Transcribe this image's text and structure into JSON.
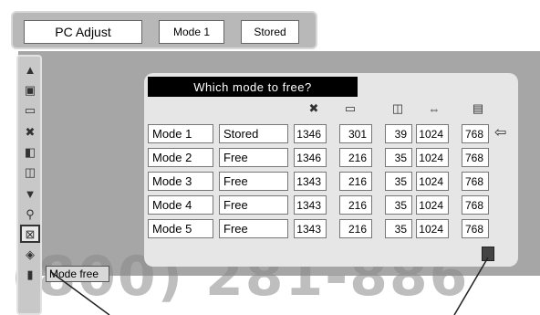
{
  "menu": {
    "title": "PC Adjust",
    "mode_label": "Mode 1",
    "stored_label": "Stored"
  },
  "sidebar": {
    "icons": [
      {
        "name": "up-arrow-icon",
        "glyph": "▲"
      },
      {
        "name": "monitor-icon",
        "glyph": "▣"
      },
      {
        "name": "fine-sync-icon",
        "glyph": "▭"
      },
      {
        "name": "total-dots-icon",
        "glyph": "✖"
      },
      {
        "name": "horizontal-icon",
        "glyph": "◧"
      },
      {
        "name": "vertical-icon",
        "glyph": "◫"
      },
      {
        "name": "down-arrow-icon",
        "glyph": "▼"
      },
      {
        "name": "reset-icon",
        "glyph": "⚲"
      },
      {
        "name": "mode-free-icon",
        "glyph": "⊠"
      },
      {
        "name": "store-icon",
        "glyph": "◈"
      },
      {
        "name": "exit-icon",
        "glyph": "▮"
      }
    ],
    "tooltip": "Mode free"
  },
  "dialog": {
    "title": "Which mode to free?",
    "column_icons": [
      "fine-sync-icon",
      "total-dots-icon",
      "horizontal-position-icon",
      "vertical-position-icon",
      "display-area-h-icon",
      "display-area-v-icon"
    ],
    "rows": [
      {
        "mode": "Mode 1",
        "status": "Stored",
        "values": [
          "1346",
          "301",
          "39",
          "1024",
          "768"
        ],
        "selected": true
      },
      {
        "mode": "Mode 2",
        "status": "Free",
        "values": [
          "1346",
          "216",
          "35",
          "1024",
          "768"
        ],
        "selected": false
      },
      {
        "mode": "Mode 3",
        "status": "Free",
        "values": [
          "1343",
          "216",
          "35",
          "1024",
          "768"
        ],
        "selected": false
      },
      {
        "mode": "Mode 4",
        "status": "Free",
        "values": [
          "1343",
          "216",
          "35",
          "1024",
          "768"
        ],
        "selected": false
      },
      {
        "mode": "Mode 5",
        "status": "Free",
        "values": [
          "1343",
          "216",
          "35",
          "1024",
          "768"
        ],
        "selected": false
      }
    ]
  },
  "watermark": "(800) 281-886",
  "colors": {
    "screen_bg": "#a6a6a6",
    "panel_bg": "#e6e6e6",
    "title_bg": "#000000"
  }
}
